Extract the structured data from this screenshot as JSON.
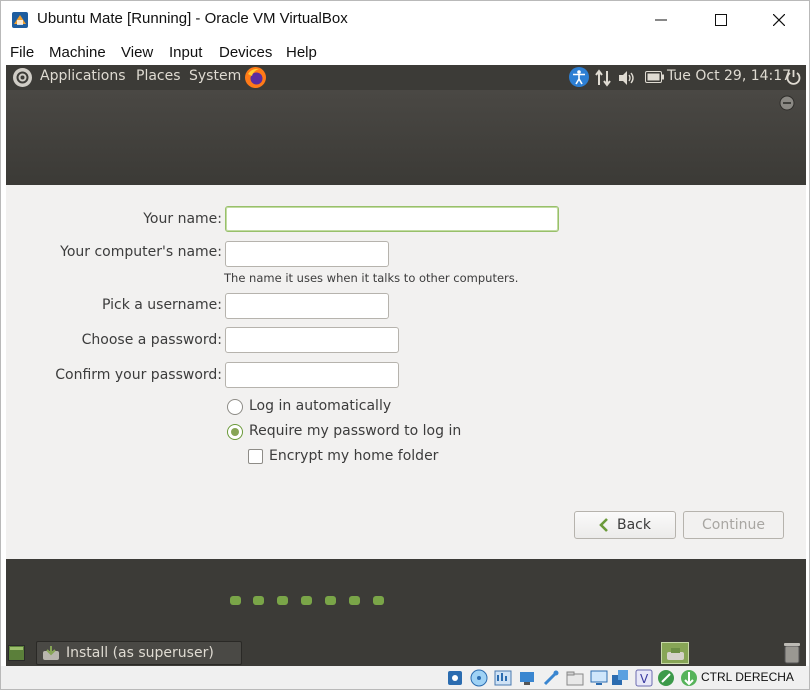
{
  "window": {
    "title": "Ubuntu Mate [Running] - Oracle VM VirtualBox"
  },
  "menu": [
    "File",
    "Machine",
    "View",
    "Input",
    "Devices",
    "Help"
  ],
  "panel": {
    "applications": "Applications",
    "places": "Places",
    "system": "System",
    "datetime": "Tue Oct 29, 14:17"
  },
  "form": {
    "name_label": "Your name:",
    "name_value": "",
    "computer_label": "Your computer's name:",
    "computer_hint": "The name it uses when it talks to other computers.",
    "username_label": "Pick a username:",
    "password_label": "Choose a password:",
    "confirm_label": "Confirm your password:",
    "login_auto": "Log in automatically",
    "require_password": "Require my password to log in",
    "encrypt_home": "Encrypt my home folder",
    "selected_login_option": "require_password",
    "encrypt_checked": false
  },
  "buttons": {
    "back": "Back",
    "continue": "Continue"
  },
  "progress": {
    "dots": 7
  },
  "taskbar": {
    "task": "Install (as superuser)"
  },
  "statusbar": {
    "host_key": "CTRL DERECHA"
  },
  "colors": {
    "accent": "#87a556",
    "panel": "#3c3b37",
    "content_bg": "#f2f1f0"
  }
}
